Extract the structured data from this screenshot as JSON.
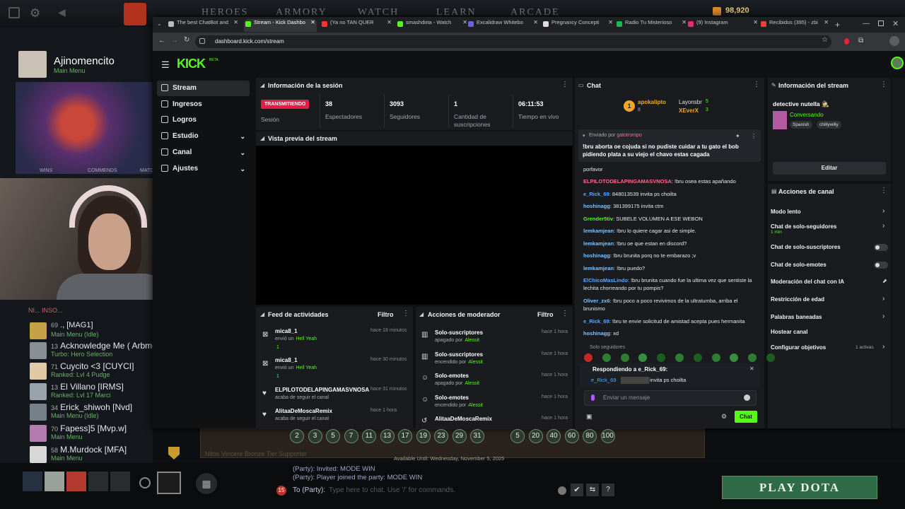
{
  "dota": {
    "tabs": [
      "HEROES",
      "ARMORY",
      "WATCH",
      "LEARN",
      "ARCADE"
    ],
    "currency": "98,920",
    "profile_name": "Ajinomencito",
    "profile_status": "Main Menu",
    "stats_labels": [
      "WINS",
      "COMMENDS",
      "MATC"
    ],
    "party_label": "NI... INSO...",
    "friends": [
      {
        "level": "69",
        "name": "., [MAG1]",
        "status": "Main Menu (Idle)"
      },
      {
        "level": "13",
        "name": "Acknowledge Me ( Arbme",
        "status": "Turbo: Hero Selection"
      },
      {
        "level": "71",
        "name": "Cuycito <3 [CUYCI]",
        "status": "Ranked: Lvl 4 Pudge"
      },
      {
        "level": "13",
        "name": "El Villano [IRMS]",
        "status": "Ranked: Lvl 17 Marci"
      },
      {
        "level": "34",
        "name": "Erick_shiwoh [Nvd]",
        "status": "Main Menu (Idle)"
      },
      {
        "level": "70",
        "name": "Fapess]5 [Mvp.w]",
        "status": "Main Menu"
      },
      {
        "level": "58",
        "name": "M.Murdock [MFA]",
        "status": "Main Menu"
      }
    ],
    "levels_a": [
      "2",
      "3",
      "5",
      "7",
      "11",
      "13",
      "17",
      "19",
      "23",
      "29",
      "31"
    ],
    "levels_b": [
      "5",
      "20",
      "40",
      "60",
      "80",
      "100"
    ],
    "available_until": "Available Until:   Wednesday, November 5, 2025",
    "chat_lines": [
      "(Party): Invited: MODE WIN",
      "(Party): Player joined the party: MODE WIN"
    ],
    "chat_prefix": "To (Party):",
    "chat_placeholder": "Type here to chat. Use '/' for commands.",
    "chat_badge": "15",
    "play_label": "PLAY DOTA",
    "tier_text": "Nitos Vincere Bronze Tier Supporter"
  },
  "browser": {
    "tabs": [
      {
        "label": "The best ChatBot and",
        "color": "#bbbbbb"
      },
      {
        "label": "Stream - Kick Dashbo",
        "color": "#53fc18",
        "active": true
      },
      {
        "label": "(Ya no TAN QUER",
        "color": "#ff3333"
      },
      {
        "label": "smashdota - Watch",
        "color": "#53fc18"
      },
      {
        "label": "Excalidraw Whitebo",
        "color": "#6965db"
      },
      {
        "label": "Pregnancy Concepti",
        "color": "#dddddd"
      },
      {
        "label": "Radio Tu Misterioso",
        "color": "#1db954"
      },
      {
        "label": "(9) Instagram",
        "color": "#e1306c"
      },
      {
        "label": "Recibidos (395) - zbi",
        "color": "#ea4335"
      }
    ],
    "url": "dashboard.kick.com/stream"
  },
  "kick": {
    "nav": [
      {
        "label": "Stream",
        "active": true,
        "chev": false
      },
      {
        "label": "Ingresos",
        "chev": false
      },
      {
        "label": "Logros",
        "chev": false
      },
      {
        "label": "Estudio",
        "chev": true
      },
      {
        "label": "Canal",
        "chev": true
      },
      {
        "label": "Ajustes",
        "chev": true
      }
    ],
    "session": {
      "title": "Información de la sesión",
      "badge": "TRANSMITIENDO",
      "badge_label": "Sesión",
      "stats": [
        {
          "value": "38",
          "label": "Espectadores"
        },
        {
          "value": "3093",
          "label": "Seguidores"
        },
        {
          "value": "1",
          "label": "Cantidad de suscripciones"
        },
        {
          "value": "06:11:53",
          "label": "Tiempo en vivo"
        }
      ]
    },
    "preview_title": "Vista previa del stream",
    "feed": {
      "title": "Feed de actividades",
      "filter": "Filtro",
      "items": [
        {
          "name": "mica8_1",
          "text": "envió un",
          "extra": "Hell Yeah",
          "count": "1",
          "time": "hace 18 minutos"
        },
        {
          "name": "mica8_1",
          "text": "envió un",
          "extra": "Hell Yeah",
          "count": "1",
          "time": "hace 30 minutos"
        },
        {
          "name": "ELPILOTODELAPINGAMASVNOSA",
          "text": "acaba de seguir el canal",
          "time": "hace 31 minutos"
        },
        {
          "name": "AlitaaDeMoscaRemix",
          "text": "acaba de seguir el canal",
          "time": "hace 1 hora"
        }
      ]
    },
    "mod": {
      "title": "Acciones de moderador",
      "filter": "Filtro",
      "items": [
        {
          "name": "Solo-suscriptores",
          "state": "apagado por",
          "by": "Alessit",
          "time": "hace 1 hora"
        },
        {
          "name": "Solo-suscriptores",
          "state": "encendido por",
          "by": "Alessit",
          "time": "hace 1 hora"
        },
        {
          "name": "Solo-emotes",
          "state": "apagado por",
          "by": "Alessit",
          "time": "hace 1 hora"
        },
        {
          "name": "Solo-emotes",
          "state": "encendido por",
          "by": "Alessit",
          "time": "hace 1 hora"
        },
        {
          "name": "AlitaaDeMoscaRemix",
          "state": "",
          "by": "",
          "time": "hace 1 hora"
        }
      ]
    },
    "chat": {
      "title": "Chat",
      "top": [
        {
          "name": "apokalipto",
          "count": "8",
          "rank": "1",
          "color": "#f5a623"
        },
        {
          "name": "Layonsbr",
          "count": "5",
          "color": "#e0e0e0"
        },
        {
          "name": "XEverX",
          "count": "3",
          "color": "#f5a623"
        }
      ],
      "pinned_by_label": "Enviado por",
      "pinned_by": "gatotrompo",
      "pinned_text": "!bru aborta oe cojuda si no pudiste cuidar a tu gato el bob pidiendo plata a su viejo el chavo estas cagada",
      "messages": [
        {
          "user": "",
          "color": "#e6e9ec",
          "text": "porfavor"
        },
        {
          "user": "ELPILOTODELAPINGAMASVNOSA",
          "color": "#ff6b8a",
          "text": ": !bru osea estas apañando"
        },
        {
          "user": "e_Rick_69",
          "color": "#5aa9ff",
          "text": ": 848013539 invita ps choilta"
        },
        {
          "user": "hoshinagg",
          "color": "#7cc4ff",
          "text": ": 381399175 invita ctm"
        },
        {
          "user": "Grender5tiv",
          "color": "#53fc18",
          "text": ": SUBELE VOLUMEN A ESE WEBON"
        },
        {
          "user": "lemkamjean",
          "color": "#7cc4ff",
          "text": ": !bru lo quiere cagar asi de simple."
        },
        {
          "user": "lemkamjean",
          "color": "#7cc4ff",
          "text": ": !bru oe que estan en discord?"
        },
        {
          "user": "hoshinagg",
          "color": "#7cc4ff",
          "text": ": !bru brunita porq no te embarazo ;v"
        },
        {
          "user": "lemkamjean",
          "color": "#7cc4ff",
          "text": ": !bru puedo?"
        },
        {
          "user": "ElChicoMasLindo",
          "color": "#5aa9ff",
          "text": ": !bru brunita cuando fue la ultima vez que sentiste la lechita chorreando por tu pompis?"
        },
        {
          "user": "Oliver_zx6",
          "color": "#7cc4ff",
          "text": ": !bru poco a poco revivimos de la ultratumba, arriba el brunismo"
        },
        {
          "user": "e_Rick_69",
          "color": "#5aa9ff",
          "text": ": !bru te envie solicitud de amistad acepta pues hermanita"
        },
        {
          "user": "hoshinagg",
          "color": "#7cc4ff",
          "text": ": xd"
        }
      ],
      "followers_only": "Solo seguidores",
      "reply_label": "Respondiendo a e_Rick_69:",
      "reply_user": "e_Rick_69",
      "reply_text": "invita ps choilta",
      "input_placeholder": "Enviar un mensaje",
      "send_label": "Chat"
    },
    "stream_info": {
      "title": "Información del stream",
      "stream_title": "detective nutella 🕵️",
      "category": "Conversando",
      "tags": [
        "Spanish",
        "chillywilly"
      ],
      "edit_label": "Editar"
    },
    "channel_actions": {
      "title": "Acciones de canal",
      "items": [
        {
          "label": "Modo lento",
          "kind": "chev"
        },
        {
          "label": "Chat de solo-seguidores",
          "sub": "1 min",
          "kind": "chev"
        },
        {
          "label": "Chat de solo-suscriptores",
          "kind": "toggle"
        },
        {
          "label": "Chat de solo-emotes",
          "kind": "toggle"
        },
        {
          "label": "Moderación del chat con IA",
          "kind": "ext"
        },
        {
          "label": "Restricción de edad",
          "kind": "chev"
        },
        {
          "label": "Palabras baneadas",
          "kind": "chev"
        },
        {
          "label": "Hostear canal",
          "kind": "none"
        },
        {
          "label": "Configurar objetivos",
          "sub": "1 activas",
          "kind": "chev"
        }
      ]
    }
  }
}
